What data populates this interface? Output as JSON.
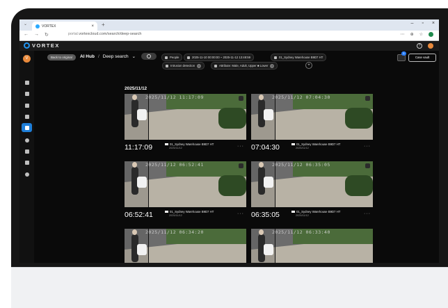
{
  "browser": {
    "tab_title": "VORTEX",
    "tab_close": "×",
    "new_tab": "+",
    "window_buttons": [
      "–",
      "▫",
      "×"
    ],
    "url_prefix": "portal.",
    "url": "vortexcloud.com/search/deep-search",
    "nav": [
      "←",
      "→",
      "↻"
    ],
    "tools": [
      "⋯",
      "⊕",
      "☆"
    ]
  },
  "app": {
    "brand": "VORTEX",
    "user_initial": "V",
    "help": "?"
  },
  "toolbar": {
    "back_label": "Back to original",
    "breadcrumb_root": "AI Hub",
    "breadcrumb_sep": "/",
    "breadcrumb_current": "Deep search",
    "breadcrumb_chevron": "⌄",
    "chips": {
      "people": "People",
      "daterange": "2025-11-10 00:00:00 ~ 2025-11-12 13:48:59",
      "camera": "01_Sydney Warehouse B9D7 HT",
      "detection": "Intrusion detection",
      "attribute": "Attribute: Male, Adult, Upper ■ Lower"
    },
    "chip_close": "×",
    "add_filter": "+",
    "cart_count": "1",
    "case_button": "Case vault"
  },
  "results": {
    "date_heading": "2025/11/12",
    "cards": [
      {
        "time": "11:17:09",
        "camera": "01_Sydney Warehouse B9D7 HT",
        "date": "2025/11/12",
        "stamp": "2025/11/12 11:17:09"
      },
      {
        "time": "07:04:30",
        "camera": "01_Sydney Warehouse B9D7 HT",
        "date": "2025/11/12",
        "stamp": "2025/11/12 07:04:30"
      },
      {
        "time": "06:52:41",
        "camera": "01_Sydney Warehouse B9D7 HT",
        "date": "2025/11/12",
        "stamp": "2025/11/12 06:52:41"
      },
      {
        "time": "06:35:05",
        "camera": "01_Sydney Warehouse B9D7 HT",
        "date": "2025/11/12",
        "stamp": "2025/11/12 06:35:05"
      },
      {
        "time": "",
        "camera": "",
        "date": "",
        "stamp": "2025/11/12 06:34:20"
      },
      {
        "time": "",
        "camera": "",
        "date": "",
        "stamp": "2025/11/12 06:33:40"
      }
    ],
    "more": "···"
  },
  "sidebar": {
    "items": [
      "grid-icon",
      "filter-icon",
      "camera-icon",
      "person-icon",
      "ai-search-icon",
      "location-icon",
      "alarm-icon",
      "archive-icon",
      "settings-icon"
    ],
    "active_index": 4
  },
  "colors": {
    "accent": "#1e7ed8",
    "avatar": "#e98a3c",
    "background": "#0a0a0a"
  }
}
